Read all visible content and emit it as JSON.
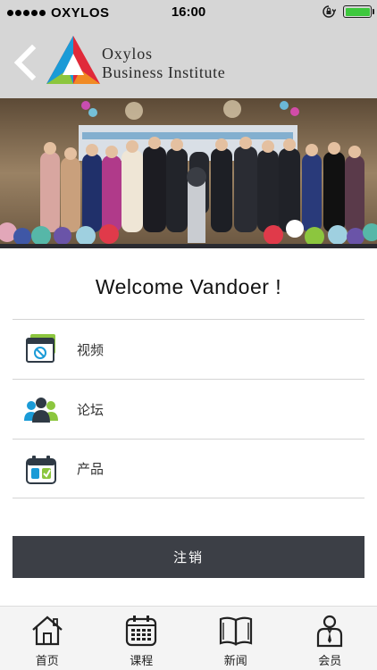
{
  "status_bar": {
    "carrier": "OXYLOS",
    "time": "16:00",
    "battery_level": 1.0
  },
  "header": {
    "brand_line1": "Oxylos",
    "brand_line2": "Business Institute",
    "back_icon": "chevron-left-icon",
    "logo_icon": "oxylos-triangle-logo"
  },
  "banner": {
    "description_icon": "event-group-photo"
  },
  "welcome": {
    "text": "Welcome Vandoer !"
  },
  "menu": {
    "items": [
      {
        "label": "视频",
        "icon": "video-window-icon"
      },
      {
        "label": "论坛",
        "icon": "people-forum-icon"
      },
      {
        "label": "产品",
        "icon": "product-calendar-icon"
      }
    ]
  },
  "logout": {
    "label": "注销"
  },
  "tabbar": {
    "items": [
      {
        "label": "首页",
        "icon": "home-icon"
      },
      {
        "label": "课程",
        "icon": "course-calendar-icon"
      },
      {
        "label": "新闻",
        "icon": "news-book-icon"
      },
      {
        "label": "会员",
        "icon": "member-icon"
      }
    ]
  },
  "colors": {
    "status_bg": "#d6d6d6",
    "button_bg": "#3c3f46",
    "battery": "#3dc83d",
    "divider": "#d4d4d4"
  }
}
